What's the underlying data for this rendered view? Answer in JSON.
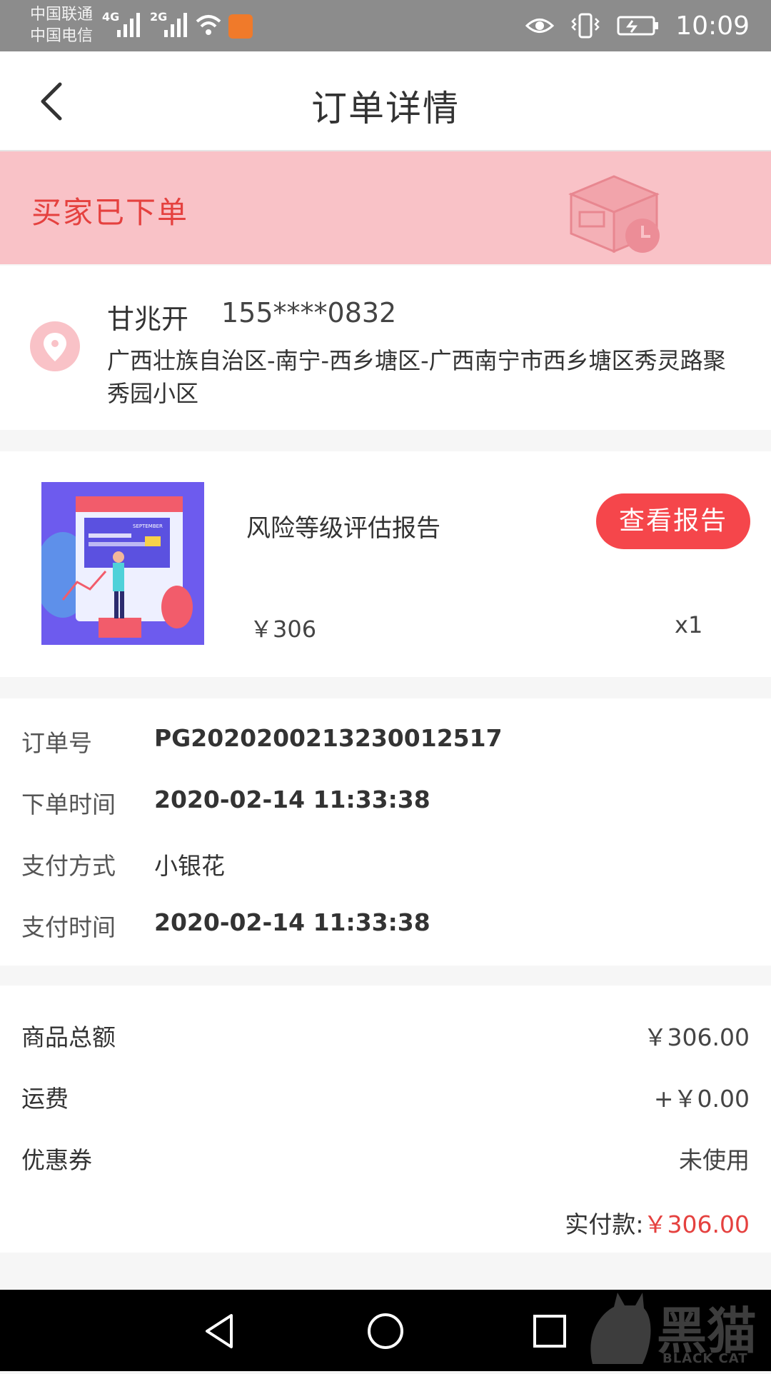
{
  "status_bar": {
    "carrier1": "中国联通",
    "carrier2": "中国电信",
    "net1": "4G",
    "net2": "2G",
    "time": "10:09"
  },
  "header": {
    "title": "订单详情",
    "back_icon": "chevron-left-icon"
  },
  "banner": {
    "status_text": "买家已下单",
    "icon": "box-clock-icon"
  },
  "address": {
    "name": "甘兆开",
    "phone": "155****0832",
    "detail": "广西壮族自治区-南宁-西乡塘区-广西南宁市西乡塘区秀灵路聚秀园小区"
  },
  "product": {
    "name": "风险等级评估报告",
    "button_label": "查看报告",
    "price": "￥306",
    "quantity": "x1",
    "thumb_text": "SEPTEMBER"
  },
  "order_info": [
    {
      "label": "订单号",
      "value": "PG2020200213230012517"
    },
    {
      "label": "下单时间",
      "value": "2020-02-14 11:33:38"
    },
    {
      "label": "支付方式",
      "value": "小银花"
    },
    {
      "label": "支付时间",
      "value": "2020-02-14 11:33:38"
    }
  ],
  "amounts": [
    {
      "label": "商品总额",
      "value": "￥306.00"
    },
    {
      "label": "运费",
      "value": "+￥0.00"
    },
    {
      "label": "优惠券",
      "value": "未使用"
    }
  ],
  "total": {
    "label": "实付款:",
    "value": "￥306.00"
  },
  "watermark": {
    "text": "黑猫",
    "sub": "BLACK CAT"
  },
  "colors": {
    "accent": "#e5413f",
    "banner_bg": "#f9c2c7",
    "button_bg": "#f5464b"
  }
}
